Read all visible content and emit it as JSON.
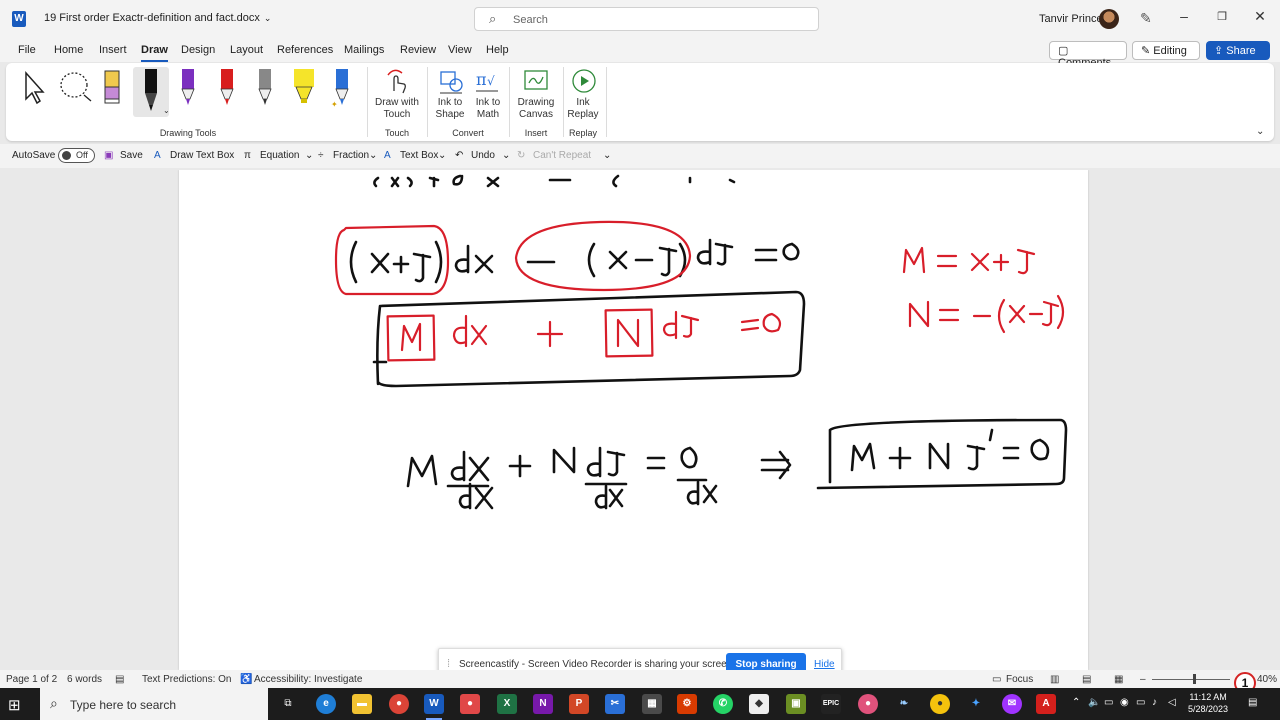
{
  "window": {
    "doc_title": "19 First order Exactr-definition and fact.docx",
    "search_placeholder": "Search",
    "user_name": "Tanvir Prince"
  },
  "menu": {
    "tabs": [
      "File",
      "Home",
      "Insert",
      "Draw",
      "Design",
      "Layout",
      "References",
      "Mailings",
      "Review",
      "View",
      "Help"
    ],
    "active_tab": "Draw",
    "comments_label": "Comments",
    "editing_label": "Editing",
    "share_label": "Share"
  },
  "ribbon": {
    "drawing_tools_label": "Drawing Tools",
    "draw_with_touch": "Draw with Touch",
    "touch_group": "Touch",
    "ink_to_shape": "Ink to Shape",
    "ink_to_math": "Ink to Math",
    "convert_group": "Convert",
    "drawing_canvas": "Drawing Canvas",
    "insert_group": "Insert",
    "ink_replay": "Ink Replay",
    "replay_group": "Replay",
    "pens": [
      {
        "name": "select-tool-icon",
        "color": "#222222"
      },
      {
        "name": "lasso-select-icon",
        "color": "#222222"
      },
      {
        "name": "eraser-icon",
        "color": "#e6c34a"
      },
      {
        "name": "black-pen-icon",
        "color": "#111111"
      },
      {
        "name": "purple-pen-icon",
        "color": "#7b2fbf"
      },
      {
        "name": "red-pen-icon",
        "color": "#d81e1e"
      },
      {
        "name": "gray-pen-icon",
        "color": "#888888"
      },
      {
        "name": "yellow-highlighter-icon",
        "color": "#f5e42a"
      },
      {
        "name": "blue-pen-icon",
        "color": "#2a6fd6"
      }
    ]
  },
  "qat": {
    "autosave": "AutoSave",
    "toggle": "Off",
    "save": "Save",
    "draw_text_box": "Draw Text Box",
    "equation": "Equation",
    "fraction": "Fraction",
    "text_box": "Text Box",
    "undo": "Undo",
    "cant_repeat": "Can't Repeat"
  },
  "screencastify": {
    "message": "Screencastify - Screen Video Recorder is sharing your screen.",
    "stop": "Stop sharing",
    "hide": "Hide"
  },
  "status": {
    "page": "Page 1 of 2",
    "words": "6 words",
    "predictions": "Text Predictions: On",
    "accessibility": "Accessibility: Investigate",
    "focus": "Focus",
    "zoom": "40%"
  },
  "taskbar": {
    "search_placeholder": "Type here to search",
    "time": "11:12 AM",
    "date": "5/28/2023",
    "notification_count": "1"
  },
  "colors": {
    "accent": "#185abd",
    "ink_black": "#111111",
    "ink_red": "#d81e2a"
  }
}
